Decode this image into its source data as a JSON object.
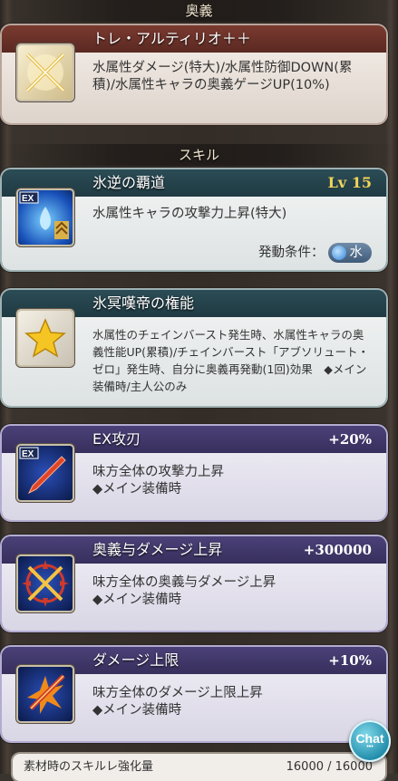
{
  "sections": {
    "ougi": "奥義",
    "skill": "スキル"
  },
  "ougi": {
    "name": "トレ・アルティリオ＋＋",
    "icon": "crossed-swords-icon",
    "desc": "水属性ダメージ(特大)/水属性防御DOWN(累積)/水属性キャラの奥義ゲージUP(10%)"
  },
  "skills": [
    {
      "name": "氷逆の覇道",
      "level": "Lv 15",
      "icon": "ex-water-skill-icon",
      "desc": "水属性キャラの攻撃力上昇(特大)",
      "condition_label": "発動条件：",
      "condition_value": "水"
    },
    {
      "name": "氷冥嘆帝の権能",
      "icon": "star-icon",
      "desc": "水属性のチェインバースト発生時、水属性キャラの奥義性能UP(累積)/チェインバースト「アブソリュート・ゼロ」発生時、自分に奥義再発動(1回)効果　◆メイン装備時/主人公のみ"
    }
  ],
  "ex_skills": [
    {
      "name": "EX攻刃",
      "value": "+20%",
      "icon": "ex-dagger-icon",
      "line1": "味方全体の攻撃力上昇",
      "line2": "◆メイン装備時"
    },
    {
      "name": "奥義与ダメージ上昇",
      "value": "+300000",
      "icon": "crossed-swords-burst-icon",
      "line1": "味方全体の奥義与ダメージ上昇",
      "line2": "◆メイン装備時"
    },
    {
      "name": "ダメージ上限",
      "value": "+10%",
      "icon": "sword-burst-icon",
      "line1": "味方全体のダメージ上限上昇",
      "line2": "◆メイン装備時"
    }
  ],
  "bottom": {
    "label": "素材時のスキルレ強化量",
    "value": "16000 / 16000"
  },
  "chat": {
    "label": "Chat",
    "sub": "•••"
  }
}
